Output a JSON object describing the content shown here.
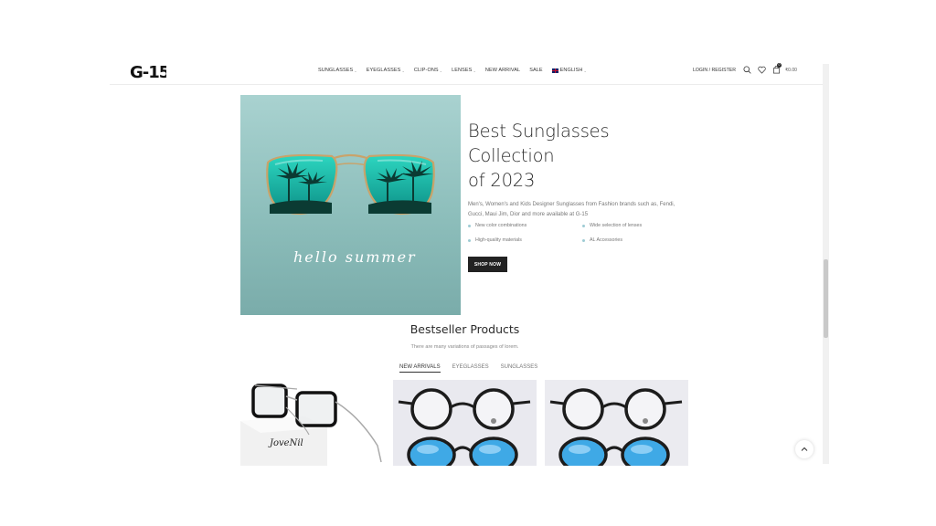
{
  "header": {
    "logo_text": "G-15",
    "nav": [
      {
        "label": "SUNGLASSES",
        "dropdown": true
      },
      {
        "label": "EYEGLASSES",
        "dropdown": true
      },
      {
        "label": "CLIP-ONS",
        "dropdown": true
      },
      {
        "label": "LENSES",
        "dropdown": true
      },
      {
        "label": "NEW ARRIVAL",
        "dropdown": false
      },
      {
        "label": "SALE",
        "dropdown": false
      },
      {
        "label": "ENGLISH",
        "dropdown": true
      }
    ],
    "login_label": "LOGIN / REGISTER",
    "cart_count": "0",
    "cart_total": "₹0.00"
  },
  "hero": {
    "title_line1": "Best Sunglasses Collection",
    "title_line2": "of 2023",
    "description": "Men's, Women's and Kids Designer Sunglasses from Fashion brands such as, Fendi, Gucci, Maui Jim, Dior and more available at G-15",
    "image_script": "hello summer",
    "features": [
      "New color combinations",
      "Wide selection of lenses",
      "High-quality materials",
      "AL Accessories"
    ],
    "button_label": "SHOP NOW"
  },
  "bestseller": {
    "title": "Bestseller Products",
    "subtitle": "There are many variations of passages of lorem.",
    "tabs": [
      "NEW ARRIVALS",
      "EYEGLASSES",
      "SUNGLASSES"
    ],
    "active_tab": "NEW ARRIVALS",
    "product1_box_text": "JoveNil"
  },
  "colors": {
    "accent": "#222222",
    "hero_bg": "#8fc0bd",
    "lens": "#1fb7a8",
    "feature_dot": "#9ecbd4"
  }
}
